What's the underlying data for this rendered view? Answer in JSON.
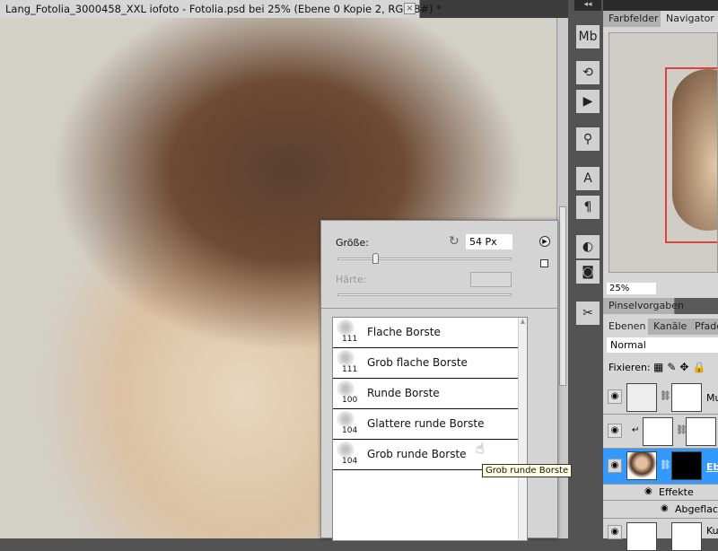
{
  "document": {
    "tab_title": "Lang_Fotolia_3000458_XXL iofoto - Fotolia.psd bei 25% (Ebene 0 Kopie 2, RGB/8#) *",
    "close_glyph": "×"
  },
  "iconstrip": {
    "collapse_glyph": "◂◂",
    "tools": [
      {
        "icon": "mini-bridge-icon",
        "glyph": "Mb"
      },
      {
        "icon": "history-icon",
        "glyph": "⟲"
      },
      {
        "icon": "actions-play-icon",
        "glyph": "▶"
      },
      {
        "icon": "brush-presets-icon",
        "glyph": "⚲"
      },
      {
        "icon": "character-icon",
        "glyph": "A"
      },
      {
        "icon": "paragraph-icon",
        "glyph": "¶"
      },
      {
        "icon": "adjustments-icon",
        "glyph": "◐"
      },
      {
        "icon": "masks-icon",
        "glyph": "◙"
      },
      {
        "icon": "tools-icon",
        "glyph": "✂"
      }
    ]
  },
  "navigator": {
    "tabs": [
      "Farbfelder",
      "Navigator"
    ],
    "active_tab": "Navigator",
    "zoom": "25%"
  },
  "brush_presets_tab": "Pinselvorgaben",
  "layers": {
    "tabs": [
      "Ebenen",
      "Kanäle",
      "Pfade"
    ],
    "blend_mode": "Normal",
    "lock_label": "Fixieren:",
    "rows": [
      {
        "name": "Mu"
      },
      {
        "name": ""
      },
      {
        "name": "Eb",
        "selected": true
      },
      {
        "name": "Ku"
      }
    ],
    "effects_label": "Effekte",
    "effect_item": "Abgeflacht"
  },
  "brush_popup": {
    "size_label": "Größe:",
    "size_value": "54 Px",
    "size_percent": 22,
    "hardness_label": "Härte:",
    "hardness_value": "",
    "brushes": [
      {
        "size": "111",
        "name": "Flache Borste"
      },
      {
        "size": "111",
        "name": "Grob flache Borste"
      },
      {
        "size": "100",
        "name": "Runde Borste"
      },
      {
        "size": "104",
        "name": "Glattere runde Borste"
      },
      {
        "size": "104",
        "name": "Grob runde Borste"
      }
    ],
    "tooltip": "Grob runde Borste"
  },
  "colors": {
    "selection": "#3399ff",
    "nav_frame": "#e04040"
  }
}
